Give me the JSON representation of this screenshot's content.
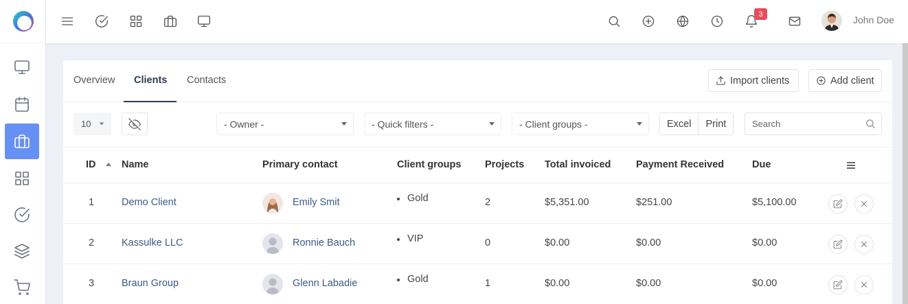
{
  "user": {
    "name": "John Doe"
  },
  "notifications": {
    "count": "3"
  },
  "colors": {
    "accent": "#6690f4",
    "badge": "#e74c5f",
    "link": "#3b5a85"
  },
  "sidebar": {
    "items": [
      {
        "icon": "monitor-icon"
      },
      {
        "icon": "calendar-icon"
      },
      {
        "icon": "briefcase-icon",
        "active": true
      },
      {
        "icon": "grid-icon"
      },
      {
        "icon": "check-circle-icon"
      },
      {
        "icon": "layers-icon"
      },
      {
        "icon": "cart-icon"
      }
    ]
  },
  "tabs": [
    "Overview",
    "Clients",
    "Contacts"
  ],
  "actions": {
    "import": "Import clients",
    "add": "Add client"
  },
  "filters": {
    "page_size": "10",
    "owner": "- Owner -",
    "quick": "- Quick filters -",
    "groups": "- Client groups -",
    "excel": "Excel",
    "print": "Print",
    "search_placeholder": "Search"
  },
  "table": {
    "headers": [
      "ID",
      "Name",
      "Primary contact",
      "Client groups",
      "Projects",
      "Total invoiced",
      "Payment Received",
      "Due"
    ],
    "rows": [
      {
        "id": "1",
        "name": "Demo Client",
        "contact": "Emily Smit",
        "group": "Gold",
        "projects": "2",
        "invoiced": "$5,351.00",
        "received": "$251.00",
        "due": "$5,100.00"
      },
      {
        "id": "2",
        "name": "Kassulke LLC",
        "contact": "Ronnie Bauch",
        "group": "VIP",
        "projects": "0",
        "invoiced": "$0.00",
        "received": "$0.00",
        "due": "$0.00"
      },
      {
        "id": "3",
        "name": "Braun Group",
        "contact": "Glenn Labadie",
        "group": "Gold",
        "projects": "1",
        "invoiced": "$0.00",
        "received": "$0.00",
        "due": "$0.00"
      }
    ]
  }
}
